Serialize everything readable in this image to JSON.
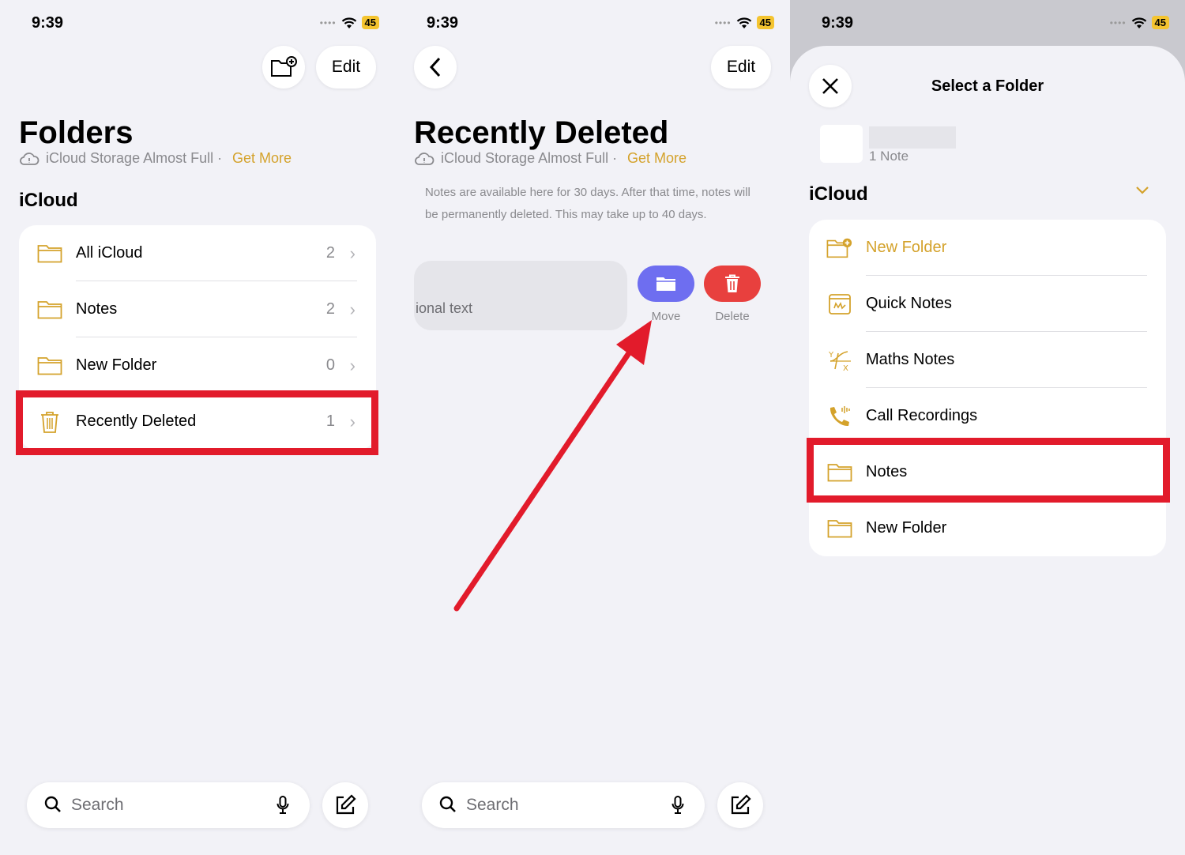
{
  "status": {
    "time": "9:39",
    "battery": "45"
  },
  "panel1": {
    "edit_label": "Edit",
    "title": "Folders",
    "storage_text": "iCloud Storage Almost Full · ",
    "storage_link": "Get More",
    "section": "iCloud",
    "folders": [
      {
        "label": "All iCloud",
        "count": "2"
      },
      {
        "label": "Notes",
        "count": "2"
      },
      {
        "label": "New Folder",
        "count": "0"
      },
      {
        "label": "Recently Deleted",
        "count": "1"
      }
    ],
    "search_placeholder": "Search"
  },
  "panel2": {
    "edit_label": "Edit",
    "title": "Recently Deleted",
    "storage_text": "iCloud Storage Almost Full · ",
    "storage_link": "Get More",
    "info": "Notes are available here for 30 days. After that time, notes will be permanently deleted. This may take up to 40 days.",
    "note_snippet": "ional text",
    "move_label": "Move",
    "delete_label": "Delete",
    "search_placeholder": "Search"
  },
  "panel3": {
    "sheet_title": "Select a Folder",
    "note_count": "1 Note",
    "section": "iCloud",
    "items": [
      {
        "label": "New Folder",
        "icon": "new-folder-icon"
      },
      {
        "label": "Quick Notes",
        "icon": "quick-notes-icon"
      },
      {
        "label": "Maths Notes",
        "icon": "maths-icon"
      },
      {
        "label": "Call Recordings",
        "icon": "phone-icon"
      },
      {
        "label": "Notes",
        "icon": "folder-icon"
      },
      {
        "label": "New Folder",
        "icon": "folder-icon"
      }
    ]
  },
  "colors": {
    "accent": "#d4a22b",
    "highlight": "#e21b2b",
    "move": "#6e6ef0",
    "delete": "#e8403e"
  }
}
